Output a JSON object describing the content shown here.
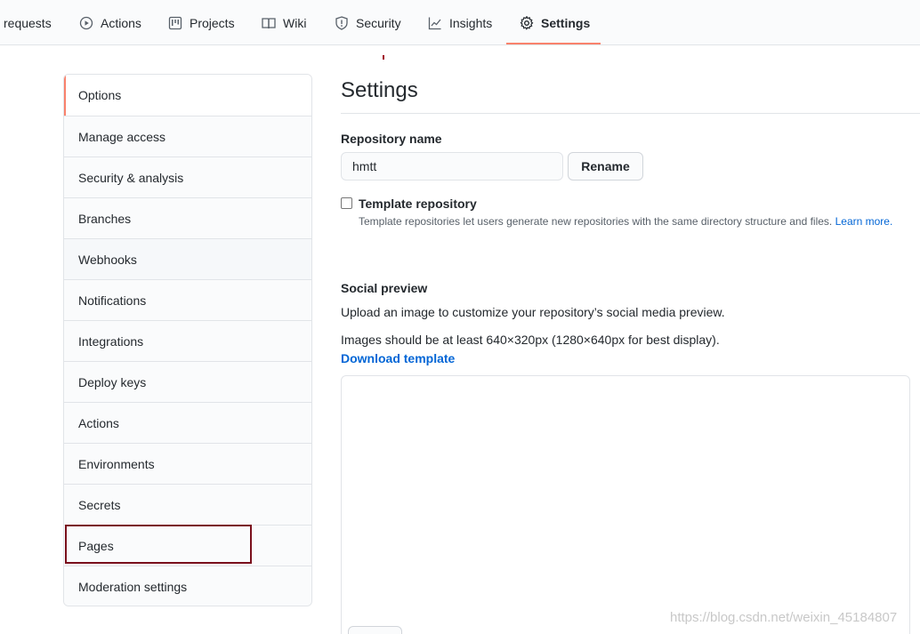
{
  "topnav": {
    "tabs": [
      {
        "label": "requests",
        "icon": ""
      },
      {
        "label": "Actions",
        "icon": "play-icon"
      },
      {
        "label": "Projects",
        "icon": "project-icon"
      },
      {
        "label": "Wiki",
        "icon": "book-icon"
      },
      {
        "label": "Security",
        "icon": "shield-icon"
      },
      {
        "label": "Insights",
        "icon": "graph-icon"
      },
      {
        "label": "Settings",
        "icon": "gear-icon",
        "selected": true
      }
    ],
    "accent_color": "#f9826c"
  },
  "sidebar": {
    "items": [
      {
        "label": "Options",
        "selected": true
      },
      {
        "label": "Manage access"
      },
      {
        "label": "Security & analysis"
      },
      {
        "label": "Branches"
      },
      {
        "label": "Webhooks"
      },
      {
        "label": "Notifications"
      },
      {
        "label": "Integrations"
      },
      {
        "label": "Deploy keys"
      },
      {
        "label": "Actions"
      },
      {
        "label": "Environments"
      },
      {
        "label": "Secrets"
      },
      {
        "label": "Pages",
        "highlighted": true
      },
      {
        "label": "Moderation settings"
      }
    ],
    "highlight_color": "#7a0f1c"
  },
  "main": {
    "title": "Settings",
    "repo_name": {
      "label": "Repository name",
      "value": "hmtt",
      "rename_label": "Rename"
    },
    "template": {
      "label": "Template repository",
      "checked": false,
      "note": "Template repositories let users generate new repositories with the same directory structure and files.",
      "learn_more": "Learn more."
    },
    "social_preview": {
      "heading": "Social preview",
      "description": "Upload an image to customize your repository’s social media preview.",
      "requirements": "Images should be at least 640×320px (1280×640px for best display).",
      "download_link": "Download template"
    }
  },
  "watermark": "https://blog.csdn.net/weixin_45184807",
  "colors": {
    "link": "#0366d6",
    "border": "#e1e4e8",
    "background_subtle": "#fafbfc"
  }
}
